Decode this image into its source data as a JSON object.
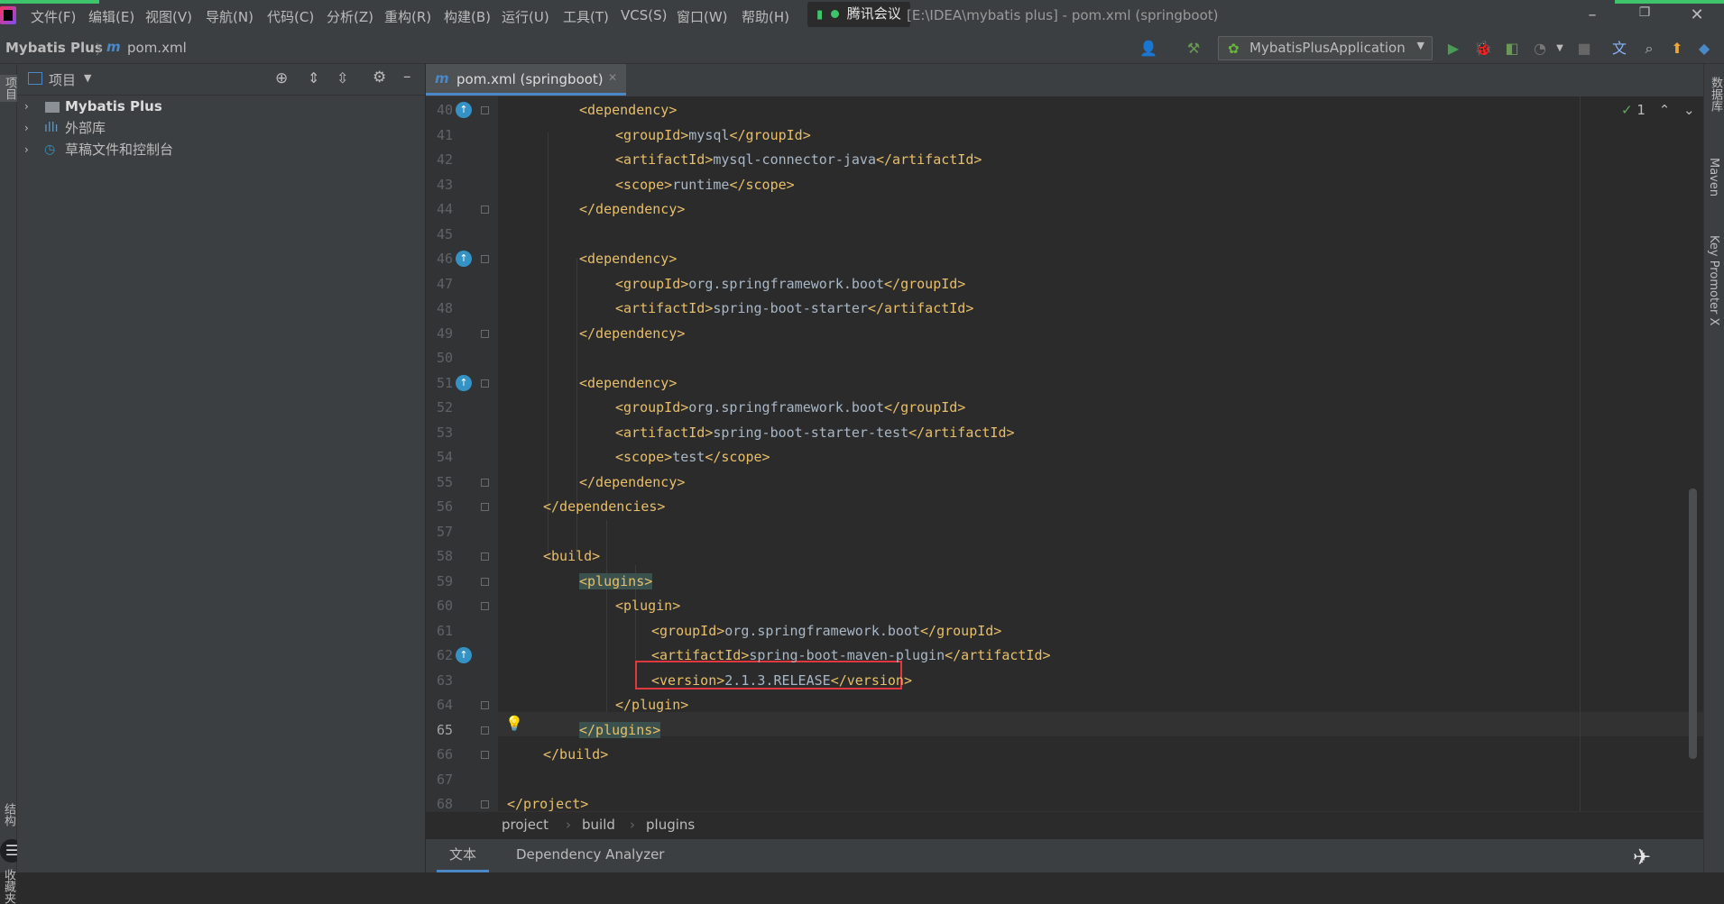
{
  "window": {
    "menu": [
      "文件(F)",
      "编辑(E)",
      "视图(V)",
      "导航(N)",
      "代码(C)",
      "分析(Z)",
      "重构(R)",
      "构建(B)",
      "运行(U)",
      "工具(T)",
      "VCS(S)",
      "窗口(W)",
      "帮助(H)"
    ],
    "meeting_label": "腾讯会议",
    "title": "[E:\\IDEA\\mybatis plus] - pom.xml (springboot)"
  },
  "nav": {
    "project": "Mybatis Plus",
    "file": "pom.xml",
    "run_config": "MybatisPlusApplication"
  },
  "project_panel": {
    "title": "项目",
    "items": [
      {
        "label": "Mybatis Plus",
        "bold": true
      },
      {
        "label": "外部库"
      },
      {
        "label": "草稿文件和控制台"
      }
    ]
  },
  "left_strip": {
    "project_label": "项目",
    "structure_label": "结构",
    "favorites_label": "收藏夹"
  },
  "right_strip": {
    "database_label": "数据库",
    "maven_label": "Maven",
    "keypromoter_label": "Key Promoter X"
  },
  "editor": {
    "tab_label": "pom.xml (springboot)",
    "inspection_count": "1",
    "lines": [
      {
        "n": "40",
        "indent": 2,
        "parts": [
          [
            "t",
            "<dependency>"
          ]
        ]
      },
      {
        "n": "41",
        "indent": 3,
        "parts": [
          [
            "t",
            "<groupId>"
          ],
          [
            "x",
            "mysql"
          ],
          [
            "t",
            "</groupId>"
          ]
        ]
      },
      {
        "n": "42",
        "indent": 3,
        "parts": [
          [
            "t",
            "<artifactId>"
          ],
          [
            "x",
            "mysql-connector-java"
          ],
          [
            "t",
            "</artifactId>"
          ]
        ]
      },
      {
        "n": "43",
        "indent": 3,
        "parts": [
          [
            "t",
            "<scope>"
          ],
          [
            "x",
            "runtime"
          ],
          [
            "t",
            "</scope>"
          ]
        ]
      },
      {
        "n": "44",
        "indent": 2,
        "parts": [
          [
            "t",
            "</dependency>"
          ]
        ]
      },
      {
        "n": "45",
        "indent": 0,
        "parts": []
      },
      {
        "n": "46",
        "indent": 2,
        "parts": [
          [
            "t",
            "<dependency>"
          ]
        ]
      },
      {
        "n": "47",
        "indent": 3,
        "parts": [
          [
            "t",
            "<groupId>"
          ],
          [
            "x",
            "org.springframework.boot"
          ],
          [
            "t",
            "</groupId>"
          ]
        ]
      },
      {
        "n": "48",
        "indent": 3,
        "parts": [
          [
            "t",
            "<artifactId>"
          ],
          [
            "x",
            "spring-boot-starter"
          ],
          [
            "t",
            "</artifactId>"
          ]
        ]
      },
      {
        "n": "49",
        "indent": 2,
        "parts": [
          [
            "t",
            "</dependency>"
          ]
        ]
      },
      {
        "n": "50",
        "indent": 0,
        "parts": []
      },
      {
        "n": "51",
        "indent": 2,
        "parts": [
          [
            "t",
            "<dependency>"
          ]
        ]
      },
      {
        "n": "52",
        "indent": 3,
        "parts": [
          [
            "t",
            "<groupId>"
          ],
          [
            "x",
            "org.springframework.boot"
          ],
          [
            "t",
            "</groupId>"
          ]
        ]
      },
      {
        "n": "53",
        "indent": 3,
        "parts": [
          [
            "t",
            "<artifactId>"
          ],
          [
            "x",
            "spring-boot-starter-test"
          ],
          [
            "t",
            "</artifactId>"
          ]
        ]
      },
      {
        "n": "54",
        "indent": 3,
        "parts": [
          [
            "t",
            "<scope>"
          ],
          [
            "x",
            "test"
          ],
          [
            "t",
            "</scope>"
          ]
        ]
      },
      {
        "n": "55",
        "indent": 2,
        "parts": [
          [
            "t",
            "</dependency>"
          ]
        ]
      },
      {
        "n": "56",
        "indent": 1,
        "parts": [
          [
            "t",
            "</dependencies>"
          ]
        ]
      },
      {
        "n": "57",
        "indent": 0,
        "parts": []
      },
      {
        "n": "58",
        "indent": 1,
        "parts": [
          [
            "t",
            "<build>"
          ]
        ]
      },
      {
        "n": "59",
        "indent": 2,
        "parts": [
          [
            "h",
            "<plugins>"
          ]
        ]
      },
      {
        "n": "60",
        "indent": 3,
        "parts": [
          [
            "t",
            "<plugin>"
          ]
        ]
      },
      {
        "n": "61",
        "indent": 4,
        "parts": [
          [
            "t",
            "<groupId>"
          ],
          [
            "x",
            "org.springframework.boot"
          ],
          [
            "t",
            "</groupId>"
          ]
        ]
      },
      {
        "n": "62",
        "indent": 4,
        "parts": [
          [
            "t",
            "<artifactId>"
          ],
          [
            "x",
            "spring-boot-maven-plugin"
          ],
          [
            "t",
            "</artifactId>"
          ]
        ]
      },
      {
        "n": "63",
        "indent": 4,
        "parts": [
          [
            "t",
            "<version>"
          ],
          [
            "x",
            "2.1.3.RELEASE"
          ],
          [
            "t",
            "</version>"
          ]
        ]
      },
      {
        "n": "64",
        "indent": 3,
        "parts": [
          [
            "t",
            "</plugin>"
          ]
        ]
      },
      {
        "n": "65",
        "indent": 2,
        "parts": [
          [
            "h",
            "</plugins>"
          ]
        ]
      },
      {
        "n": "66",
        "indent": 1,
        "parts": [
          [
            "t",
            "</build>"
          ]
        ]
      },
      {
        "n": "67",
        "indent": 0,
        "parts": []
      },
      {
        "n": "68",
        "indent": 0,
        "parts": [
          [
            "t",
            "</project>"
          ]
        ]
      }
    ]
  },
  "breadcrumbs": [
    "project",
    "build",
    "plugins"
  ],
  "bottom_tabs": [
    "文本",
    "Dependency Analyzer"
  ],
  "colors": {
    "accent": "#4a88c7",
    "highlight_box": "#e0383e",
    "tag": "#e8bf6a",
    "text": "#a9b7c6"
  }
}
